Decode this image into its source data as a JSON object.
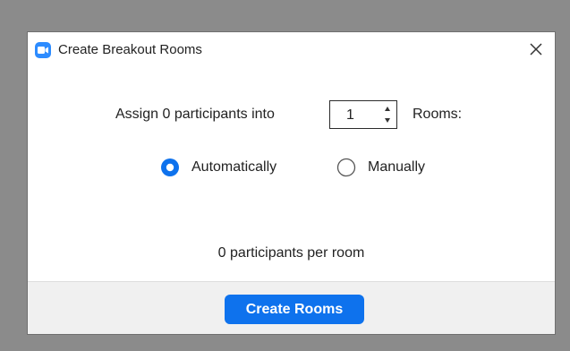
{
  "dialog": {
    "title": "Create Breakout Rooms",
    "app_icon": "zoom-camera-icon",
    "close_icon": "close-icon",
    "accent_color": "#2d8cff",
    "button_color": "#0e72ed"
  },
  "assign": {
    "prefix": "Assign 0 participants into",
    "rooms_value": "1",
    "suffix": "Rooms:"
  },
  "assignment_mode": {
    "options": [
      {
        "label": "Automatically",
        "selected": true
      },
      {
        "label": "Manually",
        "selected": false
      }
    ]
  },
  "per_room_text": "0 participants per room",
  "footer": {
    "create_label": "Create Rooms"
  }
}
